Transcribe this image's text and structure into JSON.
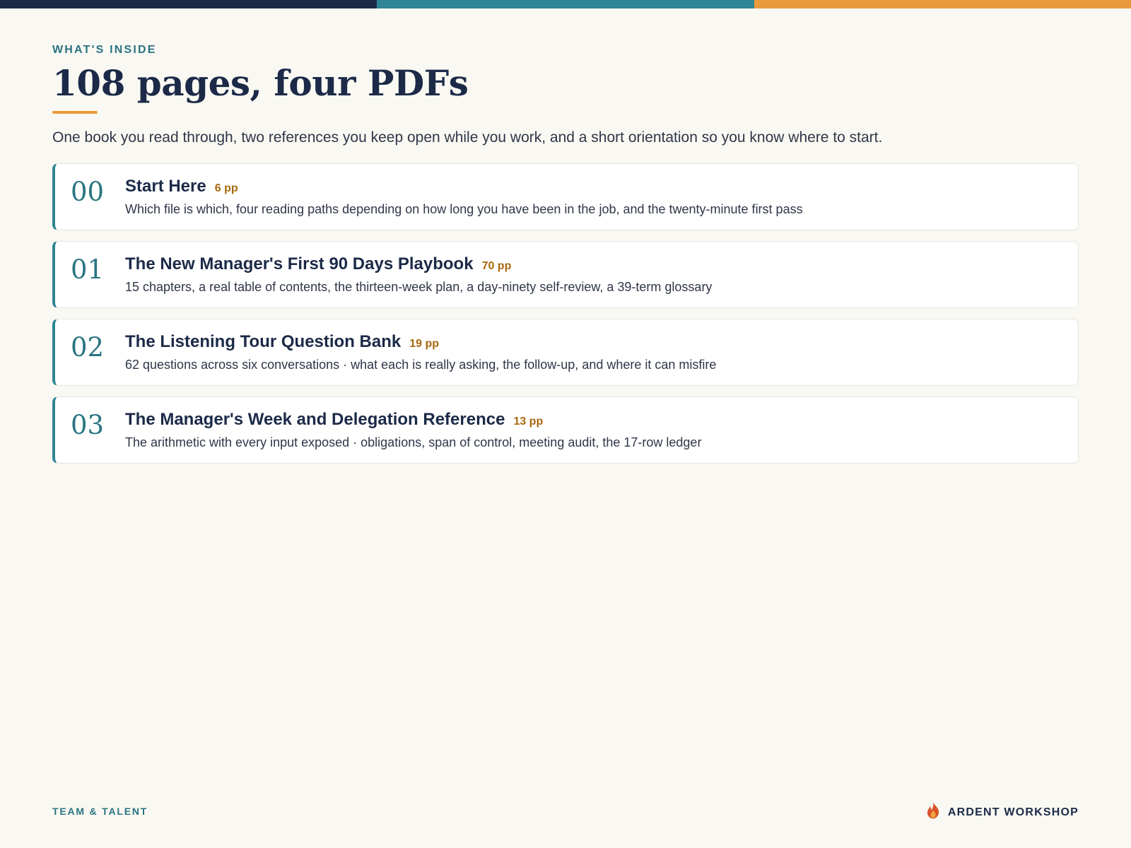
{
  "colors": {
    "navy": "#1c2a48",
    "teal": "#2e8593",
    "orange": "#e99a3c",
    "pages_accent": "#a8690e",
    "background": "#f9f8f2"
  },
  "header": {
    "eyebrow": "WHAT'S INSIDE",
    "title": "108 pages, four PDFs",
    "intro": "One book you read through, two references you keep open while you work, and a short orientation so you know where to start."
  },
  "items": [
    {
      "number": "00",
      "title": "Start Here",
      "pages": "6 pp",
      "description": "Which file is which, four reading paths depending on how long you have been in the job, and the twenty-minute first pass"
    },
    {
      "number": "01",
      "title": "The New Manager's First 90 Days Playbook",
      "pages": "70 pp",
      "description": "15 chapters, a real table of contents, the thirteen-week plan, a day-ninety self-review, a 39-term glossary"
    },
    {
      "number": "02",
      "title": "The Listening Tour Question Bank",
      "pages": "19 pp",
      "description": "62 questions across six conversations · what each is really asking, the follow-up, and where it can misfire"
    },
    {
      "number": "03",
      "title": "The Manager's Week and Delegation Reference",
      "pages": "13 pp",
      "description": "The arithmetic with every input exposed · obligations, span of control, meeting audit, the 17-row ledger"
    }
  ],
  "footer": {
    "left_label": "TEAM & TALENT",
    "brand_icon": "flame-icon",
    "brand_name": "ARDENT WORKSHOP"
  }
}
